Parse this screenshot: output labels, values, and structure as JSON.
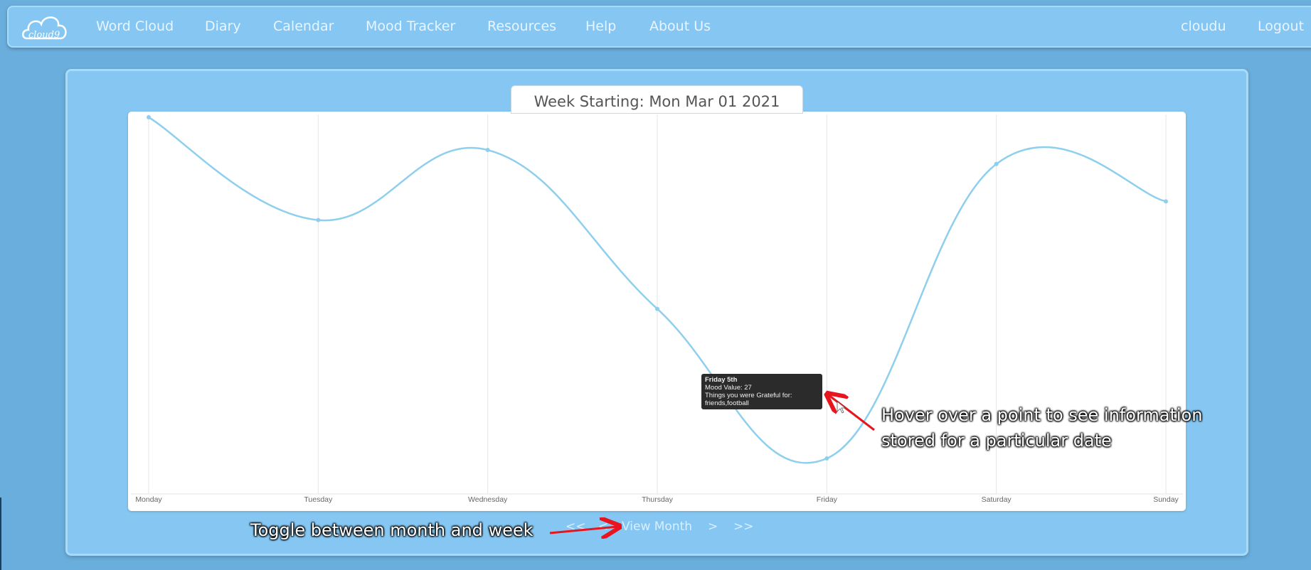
{
  "nav": {
    "brand": "cloud9",
    "links": [
      "Word Cloud",
      "Diary",
      "Calendar",
      "Mood Tracker",
      "Resources",
      "Help",
      "About Us"
    ],
    "user": "cloudu",
    "logout": "Logout"
  },
  "week_label": "Week Starting: Mon Mar 01 2021",
  "chart_data": {
    "type": "line",
    "categories": [
      "Monday",
      "Tuesday",
      "Wednesday",
      "Thursday",
      "Friday",
      "Saturday",
      "Sunday"
    ],
    "series": [
      {
        "values": [
          100,
          78,
          93,
          59,
          27,
          90,
          82
        ]
      }
    ],
    "ylim": [
      20,
      100
    ],
    "grid": true,
    "line_color": "#8ecfee"
  },
  "tooltip": {
    "title": "Friday 5th",
    "mood": "Mood Value: 27",
    "grateful_label": "Things you were Grateful for:",
    "grateful_items": "friends,football"
  },
  "bottom_nav": {
    "first": "<<",
    "prev": "<",
    "toggle": "View Month",
    "next": ">",
    "last": ">>"
  },
  "annotations": {
    "hover": [
      "Hover over a point to see information",
      "stored for a particular date"
    ],
    "toggle": "Toggle between month and week"
  },
  "colors": {
    "background": "#6aaedd",
    "panel": "#85c7f2",
    "arrow": "#e8141e"
  }
}
